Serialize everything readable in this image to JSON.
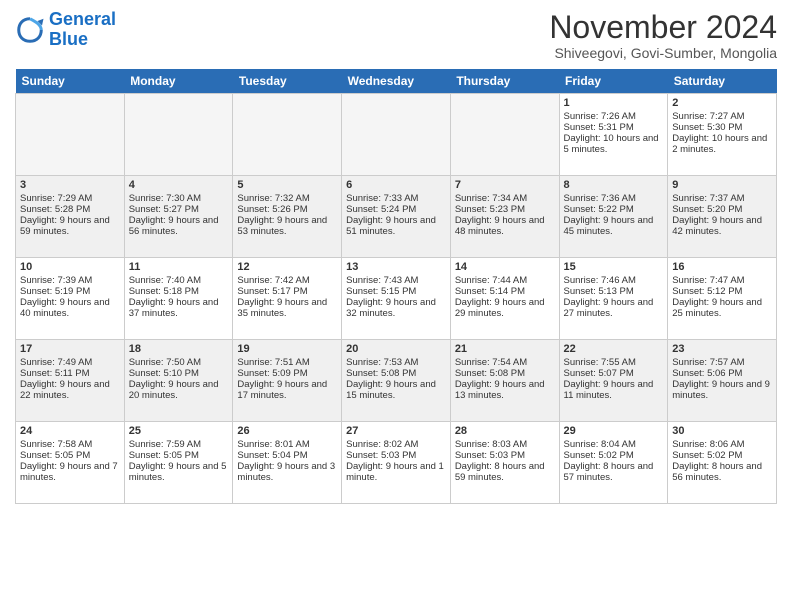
{
  "logo": {
    "line1": "General",
    "line2": "Blue"
  },
  "title": "November 2024",
  "location": "Shiveegovi, Govi-Sumber, Mongolia",
  "days_of_week": [
    "Sunday",
    "Monday",
    "Tuesday",
    "Wednesday",
    "Thursday",
    "Friday",
    "Saturday"
  ],
  "weeks": [
    [
      {
        "day": "",
        "info": "",
        "empty": true
      },
      {
        "day": "",
        "info": "",
        "empty": true
      },
      {
        "day": "",
        "info": "",
        "empty": true
      },
      {
        "day": "",
        "info": "",
        "empty": true
      },
      {
        "day": "",
        "info": "",
        "empty": true
      },
      {
        "day": "1",
        "sunrise": "Sunrise: 7:26 AM",
        "sunset": "Sunset: 5:31 PM",
        "daylight": "Daylight: 10 hours and 5 minutes.",
        "empty": false
      },
      {
        "day": "2",
        "sunrise": "Sunrise: 7:27 AM",
        "sunset": "Sunset: 5:30 PM",
        "daylight": "Daylight: 10 hours and 2 minutes.",
        "empty": false
      }
    ],
    [
      {
        "day": "3",
        "sunrise": "Sunrise: 7:29 AM",
        "sunset": "Sunset: 5:28 PM",
        "daylight": "Daylight: 9 hours and 59 minutes.",
        "empty": false
      },
      {
        "day": "4",
        "sunrise": "Sunrise: 7:30 AM",
        "sunset": "Sunset: 5:27 PM",
        "daylight": "Daylight: 9 hours and 56 minutes.",
        "empty": false
      },
      {
        "day": "5",
        "sunrise": "Sunrise: 7:32 AM",
        "sunset": "Sunset: 5:26 PM",
        "daylight": "Daylight: 9 hours and 53 minutes.",
        "empty": false
      },
      {
        "day": "6",
        "sunrise": "Sunrise: 7:33 AM",
        "sunset": "Sunset: 5:24 PM",
        "daylight": "Daylight: 9 hours and 51 minutes.",
        "empty": false
      },
      {
        "day": "7",
        "sunrise": "Sunrise: 7:34 AM",
        "sunset": "Sunset: 5:23 PM",
        "daylight": "Daylight: 9 hours and 48 minutes.",
        "empty": false
      },
      {
        "day": "8",
        "sunrise": "Sunrise: 7:36 AM",
        "sunset": "Sunset: 5:22 PM",
        "daylight": "Daylight: 9 hours and 45 minutes.",
        "empty": false
      },
      {
        "day": "9",
        "sunrise": "Sunrise: 7:37 AM",
        "sunset": "Sunset: 5:20 PM",
        "daylight": "Daylight: 9 hours and 42 minutes.",
        "empty": false
      }
    ],
    [
      {
        "day": "10",
        "sunrise": "Sunrise: 7:39 AM",
        "sunset": "Sunset: 5:19 PM",
        "daylight": "Daylight: 9 hours and 40 minutes.",
        "empty": false
      },
      {
        "day": "11",
        "sunrise": "Sunrise: 7:40 AM",
        "sunset": "Sunset: 5:18 PM",
        "daylight": "Daylight: 9 hours and 37 minutes.",
        "empty": false
      },
      {
        "day": "12",
        "sunrise": "Sunrise: 7:42 AM",
        "sunset": "Sunset: 5:17 PM",
        "daylight": "Daylight: 9 hours and 35 minutes.",
        "empty": false
      },
      {
        "day": "13",
        "sunrise": "Sunrise: 7:43 AM",
        "sunset": "Sunset: 5:15 PM",
        "daylight": "Daylight: 9 hours and 32 minutes.",
        "empty": false
      },
      {
        "day": "14",
        "sunrise": "Sunrise: 7:44 AM",
        "sunset": "Sunset: 5:14 PM",
        "daylight": "Daylight: 9 hours and 29 minutes.",
        "empty": false
      },
      {
        "day": "15",
        "sunrise": "Sunrise: 7:46 AM",
        "sunset": "Sunset: 5:13 PM",
        "daylight": "Daylight: 9 hours and 27 minutes.",
        "empty": false
      },
      {
        "day": "16",
        "sunrise": "Sunrise: 7:47 AM",
        "sunset": "Sunset: 5:12 PM",
        "daylight": "Daylight: 9 hours and 25 minutes.",
        "empty": false
      }
    ],
    [
      {
        "day": "17",
        "sunrise": "Sunrise: 7:49 AM",
        "sunset": "Sunset: 5:11 PM",
        "daylight": "Daylight: 9 hours and 22 minutes.",
        "empty": false
      },
      {
        "day": "18",
        "sunrise": "Sunrise: 7:50 AM",
        "sunset": "Sunset: 5:10 PM",
        "daylight": "Daylight: 9 hours and 20 minutes.",
        "empty": false
      },
      {
        "day": "19",
        "sunrise": "Sunrise: 7:51 AM",
        "sunset": "Sunset: 5:09 PM",
        "daylight": "Daylight: 9 hours and 17 minutes.",
        "empty": false
      },
      {
        "day": "20",
        "sunrise": "Sunrise: 7:53 AM",
        "sunset": "Sunset: 5:08 PM",
        "daylight": "Daylight: 9 hours and 15 minutes.",
        "empty": false
      },
      {
        "day": "21",
        "sunrise": "Sunrise: 7:54 AM",
        "sunset": "Sunset: 5:08 PM",
        "daylight": "Daylight: 9 hours and 13 minutes.",
        "empty": false
      },
      {
        "day": "22",
        "sunrise": "Sunrise: 7:55 AM",
        "sunset": "Sunset: 5:07 PM",
        "daylight": "Daylight: 9 hours and 11 minutes.",
        "empty": false
      },
      {
        "day": "23",
        "sunrise": "Sunrise: 7:57 AM",
        "sunset": "Sunset: 5:06 PM",
        "daylight": "Daylight: 9 hours and 9 minutes.",
        "empty": false
      }
    ],
    [
      {
        "day": "24",
        "sunrise": "Sunrise: 7:58 AM",
        "sunset": "Sunset: 5:05 PM",
        "daylight": "Daylight: 9 hours and 7 minutes.",
        "empty": false
      },
      {
        "day": "25",
        "sunrise": "Sunrise: 7:59 AM",
        "sunset": "Sunset: 5:05 PM",
        "daylight": "Daylight: 9 hours and 5 minutes.",
        "empty": false
      },
      {
        "day": "26",
        "sunrise": "Sunrise: 8:01 AM",
        "sunset": "Sunset: 5:04 PM",
        "daylight": "Daylight: 9 hours and 3 minutes.",
        "empty": false
      },
      {
        "day": "27",
        "sunrise": "Sunrise: 8:02 AM",
        "sunset": "Sunset: 5:03 PM",
        "daylight": "Daylight: 9 hours and 1 minute.",
        "empty": false
      },
      {
        "day": "28",
        "sunrise": "Sunrise: 8:03 AM",
        "sunset": "Sunset: 5:03 PM",
        "daylight": "Daylight: 8 hours and 59 minutes.",
        "empty": false
      },
      {
        "day": "29",
        "sunrise": "Sunrise: 8:04 AM",
        "sunset": "Sunset: 5:02 PM",
        "daylight": "Daylight: 8 hours and 57 minutes.",
        "empty": false
      },
      {
        "day": "30",
        "sunrise": "Sunrise: 8:06 AM",
        "sunset": "Sunset: 5:02 PM",
        "daylight": "Daylight: 8 hours and 56 minutes.",
        "empty": false
      }
    ]
  ]
}
